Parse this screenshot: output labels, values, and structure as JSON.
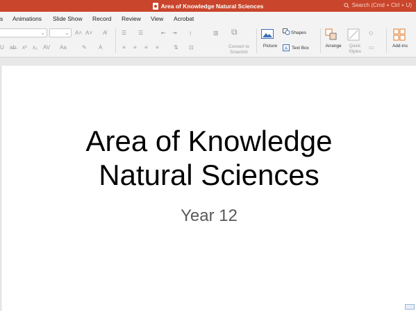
{
  "window": {
    "title": "Area of Knowledge Natural Sciences",
    "search_placeholder": "Search (Cmd + Ctrl + U)"
  },
  "tabs": [
    {
      "label": "s"
    },
    {
      "label": "Animations"
    },
    {
      "label": "Slide Show"
    },
    {
      "label": "Record"
    },
    {
      "label": "Review"
    },
    {
      "label": "View"
    },
    {
      "label": "Acrobat"
    }
  ],
  "ribbon": {
    "convert_smartart": "Convert to SmartArt",
    "picture": "Picture",
    "shapes": "Shapes",
    "text_box": "Text Box",
    "arrange": "Arrange",
    "quick_styles": "Quick Styles",
    "add_ins": "Add-ins"
  },
  "slide": {
    "title_line1": "Area of Knowledge",
    "title_line2": "Natural Sciences",
    "subtitle": "Year 12"
  },
  "colors": {
    "accent": "#c9452b",
    "addins_orange": "#e07a2e",
    "picture_blue": "#3b6fb6"
  }
}
